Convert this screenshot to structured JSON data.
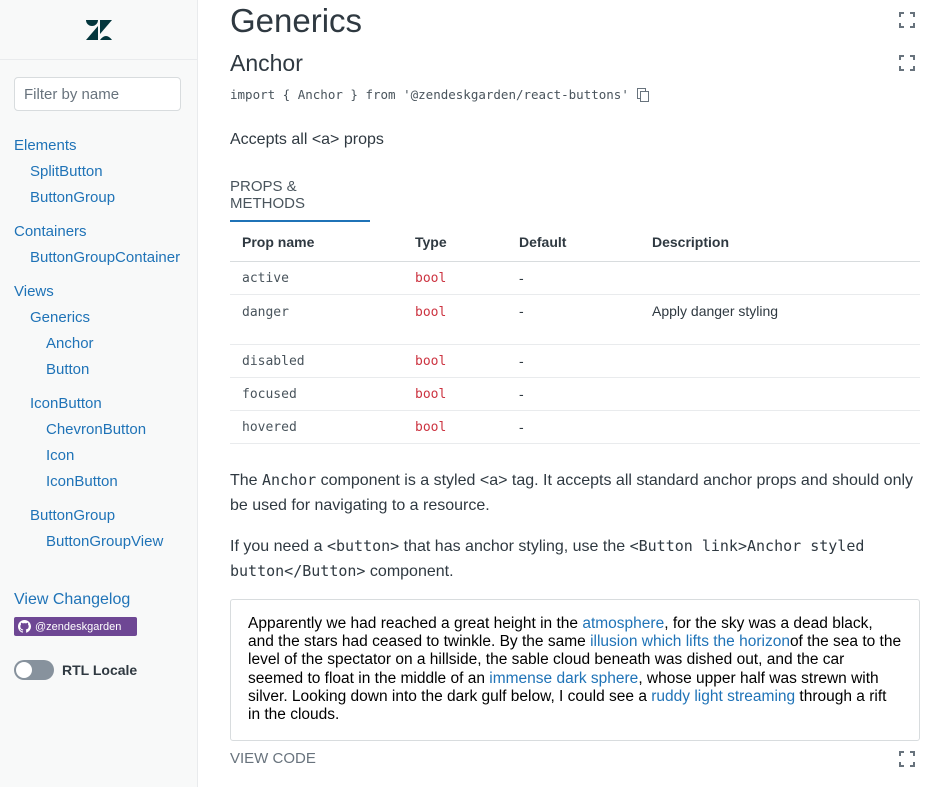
{
  "sidebar": {
    "filter_placeholder": "Filter by name",
    "items": [
      {
        "label": "Elements",
        "level": 0
      },
      {
        "label": "SplitButton",
        "level": 1
      },
      {
        "label": "ButtonGroup",
        "level": 1
      },
      {
        "label": "Containers",
        "level": 0
      },
      {
        "label": "ButtonGroupContainer",
        "level": 1
      },
      {
        "label": "Views",
        "level": 0
      },
      {
        "label": "Generics",
        "level": 1
      },
      {
        "label": "Anchor",
        "level": 2
      },
      {
        "label": "Button",
        "level": 2
      },
      {
        "label": "IconButton",
        "level": 1
      },
      {
        "label": "ChevronButton",
        "level": 2
      },
      {
        "label": "Icon",
        "level": 2
      },
      {
        "label": "IconButton",
        "level": 2
      },
      {
        "label": "ButtonGroup",
        "level": 1
      },
      {
        "label": "ButtonGroupView",
        "level": 2
      }
    ],
    "changelog_label": "View Changelog",
    "github_badge": "@zendeskgarden",
    "rtl_label": "RTL Locale",
    "rtl_enabled": false
  },
  "main": {
    "section_title": "Generics",
    "component_title": "Anchor",
    "import_statement": "import { Anchor } from '@zendeskgarden/react-buttons'",
    "accepts_text": "Accepts all <a> props",
    "tab_label": "PROPS & METHODS",
    "table": {
      "headers": [
        "Prop name",
        "Type",
        "Default",
        "Description"
      ],
      "rows": [
        {
          "name": "active",
          "type": "bool",
          "default": "-",
          "description": ""
        },
        {
          "name": "danger",
          "type": "bool",
          "default": "-",
          "description": "Apply danger styling"
        },
        {
          "name": "disabled",
          "type": "bool",
          "default": "-",
          "description": ""
        },
        {
          "name": "focused",
          "type": "bool",
          "default": "-",
          "description": ""
        },
        {
          "name": "hovered",
          "type": "bool",
          "default": "-",
          "description": ""
        }
      ]
    },
    "para1": {
      "t1": "The ",
      "code1": "Anchor",
      "t2": " component is a styled <a> tag. It accepts all standard anchor props and should only be used for navigating to a resource."
    },
    "para2": {
      "t1": "If you need a ",
      "code1": "<button>",
      "t2": " that has anchor styling, use the ",
      "code2": "<Button link>Anchor styled button</Button>",
      "t3": " component."
    },
    "demo": {
      "s1": "Apparently we had reached a great height in the ",
      "a1": "atmosphere",
      "s2": ", for the sky was a dead black, and the stars had ceased to twinkle. By the same ",
      "a2": "illusion which lifts the horizon",
      "s3": "of the sea to the level of the spectator on a hillside, the sable cloud beneath was dished out, and the car seemed to float in the middle of an ",
      "a3": "immense dark sphere",
      "s4": ", whose upper half was strewn with silver. Looking down into the dark gulf below, I could see a ",
      "a4": "ruddy light streaming",
      "s5": " through a rift in the clouds."
    },
    "view_code_label": "VIEW CODE"
  },
  "icons": {
    "logo": "zendesk-logo",
    "expand": "expand-icon",
    "copy": "copy-icon",
    "github": "github-icon"
  },
  "colors": {
    "link": "#1f73b7",
    "danger_type": "#cc3340",
    "badge": "#6e4794"
  }
}
